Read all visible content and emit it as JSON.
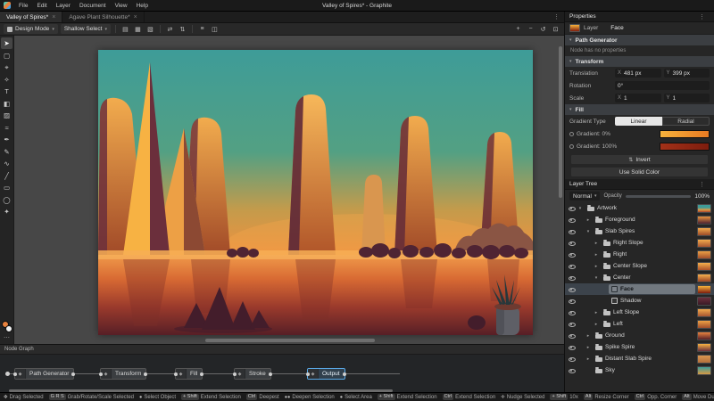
{
  "glyphs": {
    "caret": "▾",
    "dots": "⋮",
    "close": "×",
    "overflow": "⋯"
  },
  "window": {
    "title": "Valley of Spires* - Graphite",
    "menus": [
      "File",
      "Edit",
      "Layer",
      "Document",
      "View",
      "Help"
    ]
  },
  "tabs": {
    "items": [
      {
        "label": "Valley of Spires*"
      },
      {
        "label": "Agave Plant Silhouette*"
      }
    ]
  },
  "toolbar": {
    "design_mode": "Design Mode",
    "selection_mode": "Shallow Select",
    "icons_left": [
      {
        "name": "snap-icon",
        "glyph": "▤"
      },
      {
        "name": "grid-icon",
        "glyph": "▦"
      },
      {
        "name": "overlays-icon",
        "glyph": "▧"
      },
      {
        "name": "flip-horizontal-icon",
        "glyph": "⇄"
      },
      {
        "name": "flip-vertical-icon",
        "glyph": "⇅"
      },
      {
        "name": "align-icon",
        "glyph": "≡"
      },
      {
        "name": "boolean-icon",
        "glyph": "◫"
      }
    ],
    "icons_right": [
      {
        "name": "zoom-in-icon",
        "glyph": "+"
      },
      {
        "name": "zoom-out-icon",
        "glyph": "−"
      },
      {
        "name": "zoom-reset-icon",
        "glyph": "↺"
      },
      {
        "name": "fit-view-icon",
        "glyph": "⊡"
      }
    ]
  },
  "tools": {
    "items": [
      {
        "name": "select-tool",
        "glyph": "➤"
      },
      {
        "name": "artboard-tool",
        "glyph": "▢"
      },
      {
        "name": "navigate-tool",
        "glyph": "⌖"
      },
      {
        "name": "eyedropper-tool",
        "glyph": "✧"
      },
      {
        "name": "text-tool",
        "glyph": "T"
      },
      {
        "name": "fill-tool",
        "glyph": "◧"
      },
      {
        "name": "gradient-tool",
        "glyph": "▨"
      },
      {
        "name": "path-tool",
        "glyph": "≈"
      },
      {
        "name": "pen-tool",
        "glyph": "✒"
      },
      {
        "name": "freehand-tool",
        "glyph": "✎"
      },
      {
        "name": "spline-tool",
        "glyph": "∿"
      },
      {
        "name": "line-tool",
        "glyph": "╱"
      },
      {
        "name": "rectangle-tool",
        "glyph": "▭"
      },
      {
        "name": "ellipse-tool",
        "glyph": "◯"
      },
      {
        "name": "shape-tool",
        "glyph": "✦"
      }
    ],
    "primary_color": "#e8823e",
    "secondary_color": "#f0f0f0",
    "primary_css": "background:#e8823e",
    "secondary_css": "background:#f0f0f0"
  },
  "properties": {
    "title": "Properties",
    "breadcrumb": {
      "kind": "Layer",
      "name": "Face"
    },
    "sections": {
      "path_generator": {
        "title": "Path Generator",
        "message": "Node has no properties"
      },
      "transform": {
        "title": "Transform",
        "translation_label": "Translation",
        "x_key": "X",
        "translation_x": "481 px",
        "y_key": "Y",
        "translation_y": "399 px",
        "rotation_label": "Rotation",
        "rotation": "0°",
        "scale_label": "Scale",
        "scale_x": "1",
        "scale_y": "1"
      },
      "fill": {
        "title": "Fill",
        "gradient_type_label": "Gradient Type",
        "linear_label": "Linear",
        "radial_label": "Radial",
        "selected_type": "Linear",
        "stop0_label": "Gradient: 0%",
        "stop0_css": "background:linear-gradient(90deg,#f6b23c,#e87a22)",
        "stop100_label": "Gradient: 100%",
        "stop100_css": "background:linear-gradient(90deg,#a33118,#7e1d0e)",
        "invert_glyph": "⇅",
        "invert_label": "Invert",
        "solid_label": "Use Solid Color"
      }
    }
  },
  "layer_tree": {
    "title": "Layer Tree",
    "blend_mode": "Normal",
    "opacity_label": "Opacity",
    "opacity_value": "100%",
    "rows": [
      {
        "arrow": "▾",
        "label": "Artwork",
        "indent": 0,
        "thumb_css": "background:linear-gradient(180deg,#3f9c98 35%,#e09a42 70%,#a8432a)"
      },
      {
        "arrow": "▸",
        "label": "Foreground",
        "indent": 1,
        "thumb_css": "background:linear-gradient(180deg,#e8923e,#4a2130)"
      },
      {
        "arrow": "▾",
        "label": "Slab Spires",
        "indent": 1,
        "thumb_css": "background:linear-gradient(180deg,#f2a94c,#9c4b28)"
      },
      {
        "arrow": "▸",
        "label": "Right Slope",
        "indent": 2,
        "thumb_css": "background:linear-gradient(180deg,#f2a94c,#a85530)"
      },
      {
        "arrow": "▸",
        "label": "Right",
        "indent": 2,
        "thumb_css": "background:linear-gradient(180deg,#eda045,#a14e2b)"
      },
      {
        "arrow": "▸",
        "label": "Center Slope",
        "indent": 2,
        "thumb_css": "background:linear-gradient(180deg,#f5b04e,#ad5229)"
      },
      {
        "arrow": "▾",
        "label": "Center",
        "indent": 2,
        "thumb_css": "background:linear-gradient(180deg,#f5b04e,#9c4424)"
      },
      {
        "arrow": "",
        "label": "Face",
        "indent": 3,
        "selected": true,
        "thumb_css": "background:linear-gradient(180deg,#f6b23c,#7e1d0e)"
      },
      {
        "arrow": "",
        "label": "Shadow",
        "indent": 3,
        "thumb_css": "background:linear-gradient(180deg,#6b2f3c,#3a1a26)"
      },
      {
        "arrow": "▸",
        "label": "Left Slope",
        "indent": 2,
        "thumb_css": "background:linear-gradient(180deg,#f2a94c,#a85530)"
      },
      {
        "arrow": "▸",
        "label": "Left",
        "indent": 2,
        "thumb_css": "background:linear-gradient(180deg,#eda045,#a14e2b)"
      },
      {
        "arrow": "▸",
        "label": "Ground",
        "indent": 1,
        "thumb_css": "background:linear-gradient(180deg,#e8823e,#571f26)"
      },
      {
        "arrow": "▸",
        "label": "Spike Spire",
        "indent": 1,
        "thumb_css": "background:linear-gradient(180deg,#f7b243,#6b2f3c)"
      },
      {
        "arrow": "▸",
        "label": "Distant Slab Spire",
        "indent": 1,
        "thumb_css": "background:linear-gradient(180deg,#d9964f,#b4703c)"
      },
      {
        "arrow": "",
        "label": "Sky",
        "indent": 1,
        "thumb_css": "background:linear-gradient(180deg,#3f9c98,#d89a43)"
      }
    ]
  },
  "node_graph": {
    "title": "Node Graph",
    "nodes": [
      {
        "label": "Path Generator",
        "glyph": "◆"
      },
      {
        "label": "Transform",
        "glyph": "◆"
      },
      {
        "label": "Fill",
        "glyph": "◆"
      },
      {
        "label": "Stroke",
        "glyph": "◆"
      },
      {
        "label": "Output",
        "glyph": "◆",
        "selected": true
      }
    ]
  },
  "hints": [
    {
      "icon": "✥",
      "keys": "",
      "label": "Drag Selected"
    },
    {
      "icon": "",
      "keys": "G R S",
      "label": "Grab/Rotate/Scale Selected"
    },
    {
      "icon": "●",
      "keys": "",
      "label": "Select Object"
    },
    {
      "icon": "",
      "keys": "+ Shift",
      "label": "Extend Selection"
    },
    {
      "icon": "",
      "keys": "Ctrl",
      "label": "Deepest"
    },
    {
      "icon": "●●",
      "keys": "",
      "label": "Deepen Selection"
    },
    {
      "icon": "●",
      "keys": "",
      "label": "Select Area"
    },
    {
      "icon": "",
      "keys": "+ Shift",
      "label": "Extend Selection"
    },
    {
      "icon": "",
      "keys": "Ctrl",
      "label": "Extend Selection"
    },
    {
      "icon": "✛",
      "keys": "",
      "label": "Nudge Selected"
    },
    {
      "icon": "",
      "keys": "+ Shift",
      "label": "10x"
    },
    {
      "icon": "",
      "keys": "Alt",
      "label": "Resize Corner"
    },
    {
      "icon": "",
      "keys": "Ctrl",
      "label": "Opp. Corner"
    },
    {
      "icon": "",
      "keys": "Alt",
      "label": "Move Duplicate"
    }
  ]
}
